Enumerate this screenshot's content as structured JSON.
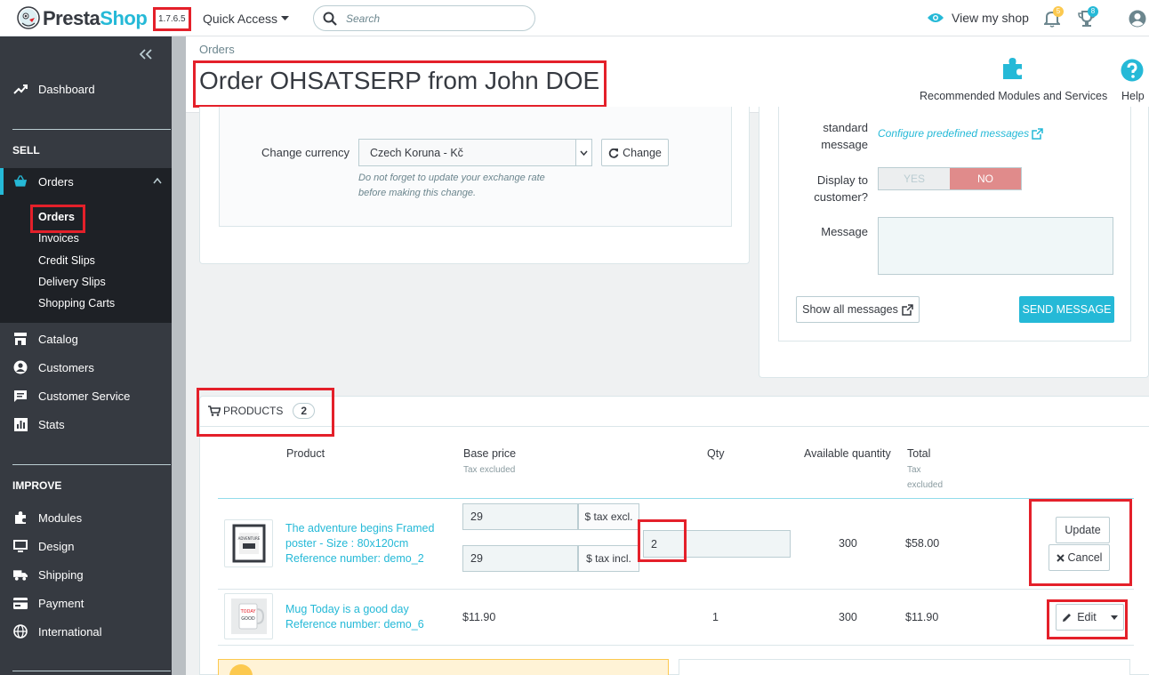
{
  "header": {
    "logo_part1": "Presta",
    "logo_part2": "Shop",
    "version": "1.7.6.5",
    "quick_access": "Quick Access",
    "search_placeholder": "Search",
    "view_shop": "View my shop",
    "notifications_count": "5",
    "orders_badge_count": "8"
  },
  "sidebar": {
    "dashboard": "Dashboard",
    "sell_section": "SELL",
    "orders": "Orders",
    "sub_orders": "Orders",
    "sub_invoices": "Invoices",
    "sub_credit_slips": "Credit Slips",
    "sub_delivery_slips": "Delivery Slips",
    "sub_shopping_carts": "Shopping Carts",
    "catalog": "Catalog",
    "customers": "Customers",
    "customer_service": "Customer Service",
    "stats": "Stats",
    "improve_section": "IMPROVE",
    "modules": "Modules",
    "design": "Design",
    "shipping": "Shipping",
    "payment": "Payment",
    "international": "International"
  },
  "page": {
    "breadcrumb": "Orders",
    "title": "Order OHSATSERP from John DOE",
    "recommended": "Recommended Modules and Services",
    "help": "Help"
  },
  "currency": {
    "label": "Change currency",
    "selected": "Czech Koruna - Kč",
    "change_button": "Change",
    "help_line1": "Do not forget to update your exchange rate",
    "help_line2": "before making this change."
  },
  "message": {
    "standard_label": "standard",
    "standard_label2": "message",
    "configure_link": "Configure predefined messages",
    "display_label1": "Display to",
    "display_label2": "customer?",
    "yes": "YES",
    "no": "NO",
    "message_label": "Message",
    "show_all": "Show all messages",
    "send": "SEND MESSAGE"
  },
  "products": {
    "heading": "PRODUCTS",
    "count": "2",
    "columns": {
      "product": "Product",
      "base_price": "Base price",
      "base_price_sub": "Tax excluded",
      "qty": "Qty",
      "available": "Available quantity",
      "total": "Total",
      "total_sub1": "Tax",
      "total_sub2": "excluded"
    },
    "rows": [
      {
        "name_line1": "The adventure begins Framed",
        "name_line2": "poster - Size : 80x120cm",
        "reference": "Reference number: demo_2",
        "price_excl": "29",
        "price_excl_addon": "$ tax excl.",
        "price_incl": "29",
        "price_incl_addon": "$ tax incl.",
        "qty": "2",
        "available": "300",
        "total": "$58.00",
        "update_button": "Update",
        "cancel_button": "Cancel"
      },
      {
        "name_line1": "Mug Today is a good day",
        "reference": "Reference number: demo_6",
        "price": "$11.90",
        "qty": "1",
        "available": "300",
        "total": "$11.90",
        "edit_button": "Edit"
      }
    ]
  }
}
